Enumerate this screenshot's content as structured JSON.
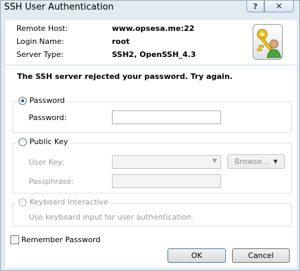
{
  "window": {
    "title": "SSH User Authentication",
    "help_label": "?",
    "close_label": "✕"
  },
  "info": {
    "remote_host_label": "Remote Host:",
    "remote_host_value": "www.opsesa.me:22",
    "login_name_label": "Login Name:",
    "login_name_value": "root",
    "server_type_label": "Server Type:",
    "server_type_value": "SSH2, OpenSSH_4.3",
    "logo_icon": "keys-user-icon"
  },
  "message": "The SSH server rejected your password. Try again.",
  "password_group": {
    "title": "Password",
    "selected": true,
    "password_label": "Password:",
    "password_value": ""
  },
  "publickey_group": {
    "title": "Public Key",
    "selected": false,
    "user_key_label": "User Key:",
    "user_key_value": "",
    "browse_label": "Browse...",
    "passphrase_label": "Passphrase:",
    "passphrase_value": ""
  },
  "keyboard_group": {
    "title": "Keyboard Interactive",
    "selected": false,
    "description": "Use keyboard input for user authentication."
  },
  "remember_password": {
    "label": "Remember Password",
    "checked": false
  },
  "buttons": {
    "ok_label": "OK",
    "cancel_label": "Cancel"
  }
}
